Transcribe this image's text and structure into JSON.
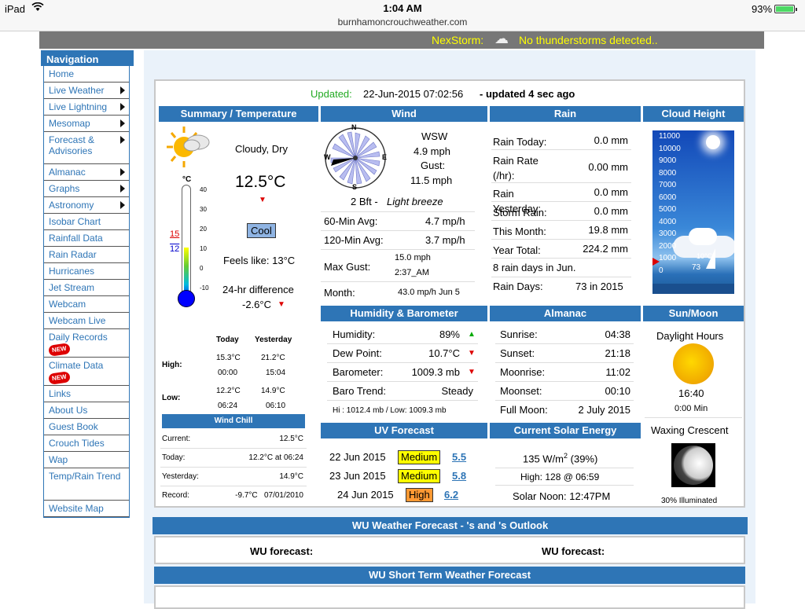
{
  "status_bar": {
    "carrier": "iPad",
    "time": "1:04 AM",
    "url": "burnhamoncrouchweather.com",
    "battery": "93%"
  },
  "nexstorm": {
    "label": "NexStorm:",
    "message": "No thunderstorms detected.."
  },
  "nav": {
    "title": "Navigation",
    "items": [
      {
        "label": "Home"
      },
      {
        "label": "Live Weather"
      },
      {
        "label": "Live Lightning"
      },
      {
        "label": "Mesomap"
      },
      {
        "label": "Forecast & Advisories"
      },
      {
        "label": "Almanac"
      },
      {
        "label": "Graphs"
      },
      {
        "label": "Astronomy"
      },
      {
        "label": "Isobar Chart"
      },
      {
        "label": "Rainfall Data"
      },
      {
        "label": "Rain Radar"
      },
      {
        "label": "Hurricanes"
      },
      {
        "label": "Jet Stream"
      },
      {
        "label": "Webcam"
      },
      {
        "label": "Webcam Live"
      },
      {
        "label": "Daily Records",
        "badge": "NEW"
      },
      {
        "label": "Climate Data",
        "badge": "NEW"
      },
      {
        "label": "Links"
      },
      {
        "label": "About Us"
      },
      {
        "label": "Guest Book"
      },
      {
        "label": "Crouch Tides"
      },
      {
        "label": "Wap"
      },
      {
        "label": "Temp/Rain Trend"
      },
      {
        "label": "Website Map"
      }
    ]
  },
  "updated": {
    "label": "Updated:",
    "datetime": "22-Jun-2015 07:02:56",
    "suffix": "- updated 4 sec ago"
  },
  "headers": {
    "summary": "Summary / Temperature",
    "wind": "Wind",
    "rain": "Rain",
    "cloud": "Cloud Height",
    "humidity": "Humidity & Barometer",
    "almanac": "Almanac",
    "sunmoon": "Sun/Moon",
    "uv": "UV Forecast",
    "solar": "Current Solar Energy",
    "windchill": "Wind Chill"
  },
  "summary": {
    "condition": "Cloudy, Dry",
    "temp": "12.5°C",
    "feel_badge": "Cool",
    "feels_like": "Feels like: 13°C",
    "diff_label": "24-hr difference",
    "diff_value": "-2.6°C",
    "thermo_unit": "°C",
    "thermo_hi": "15",
    "thermo_lo": "12",
    "thermo_ticks": [
      "40",
      "30",
      "20",
      "10",
      "0",
      "-10"
    ],
    "cols": {
      "today": "Today",
      "yesterday": "Yesterday"
    },
    "high": {
      "label": "High:",
      "today_val": "15.3°C",
      "today_time": "00:00",
      "yest_val": "21.2°C",
      "yest_time": "15:04"
    },
    "low": {
      "label": "Low:",
      "today_val": "12.2°C",
      "today_time": "06:24",
      "yest_val": "14.9°C",
      "yest_time": "06:10"
    }
  },
  "windchill": {
    "rows": [
      {
        "label": "Current:",
        "value": "12.5°C"
      },
      {
        "label": "Today:",
        "value": "12.2°C at 06:24"
      },
      {
        "label": "Yesterday:",
        "value": "14.9°C"
      },
      {
        "label": "Record:",
        "value": "-9.7°C   07/01/2010"
      }
    ]
  },
  "wind": {
    "direction": "WSW",
    "speed": "4.9 mph",
    "gust_label": "Gust:",
    "gust": "11.5 mph",
    "compass": {
      "n": "N",
      "e": "E",
      "s": "S",
      "w": "W"
    },
    "beaufort": "2 Bft -",
    "beaufort_desc": "Light breeze",
    "avg60_label": "60-Min Avg:",
    "avg60": "4.7 mp/h",
    "avg120_label": "120-Min Avg:",
    "avg120": "3.7 mp/h",
    "maxgust_label": "Max Gust:",
    "maxgust": "15.0 mph",
    "maxgust_time": "2:37_AM",
    "month_label": "Month:",
    "month": "43.0 mp/h Jun 5"
  },
  "rain": {
    "rows": [
      {
        "label": "Rain Today:",
        "value": "0.0 mm"
      },
      {
        "label": "Rain Rate (/hr):",
        "value": "0.00 mm"
      },
      {
        "label": "Rain Yesterday:",
        "value": "0.0 mm"
      },
      {
        "label": "Storm Rain:",
        "value": "0.0 mm"
      },
      {
        "label": "This Month:",
        "value": "19.8 mm"
      },
      {
        "label": "Year Total:",
        "value": "224.2 mm"
      }
    ],
    "rain_days_month": "8 rain days in Jun.",
    "rain_days_label": "Rain Days:",
    "rain_days_year": "73 in 2015"
  },
  "cloud": {
    "ticks": [
      "11000",
      "10000",
      "9000",
      "8000",
      "7000",
      "6000",
      "5000",
      "4000",
      "3000",
      "2000",
      "1000",
      "0"
    ],
    "temp_label": "10°C",
    "height_label": "73"
  },
  "humidity": {
    "rows": [
      {
        "label": "Humidity:",
        "value": "89%",
        "trend": "up"
      },
      {
        "label": "Dew Point:",
        "value": "10.7°C",
        "trend": "down"
      },
      {
        "label": "Barometer:",
        "value": "1009.3 mb",
        "trend": "down"
      },
      {
        "label": "Baro Trend:",
        "value": "Steady",
        "trend": ""
      }
    ],
    "hilo": "Hi : 1012.4 mb / Low:  1009.3 mb"
  },
  "almanac": {
    "rows": [
      {
        "label": "Sunrise:",
        "value": "04:38"
      },
      {
        "label": "Sunset:",
        "value": "21:18"
      },
      {
        "label": "Moonrise:",
        "value": "11:02"
      },
      {
        "label": "Moonset:",
        "value": "00:10"
      },
      {
        "label": "Full Moon:",
        "value": "2 July 2015"
      }
    ]
  },
  "sunmoon": {
    "daylight_label": "Daylight Hours",
    "daylight": "16:40",
    "change": "0:00 Min",
    "phase": "Waxing Crescent",
    "illuminated": "30% Illuminated"
  },
  "uv": {
    "rows": [
      {
        "date": "22 Jun 2015",
        "level": "Medium",
        "value": "5.5",
        "color": "#ffff00"
      },
      {
        "date": "23 Jun 2015",
        "level": "Medium",
        "value": "5.8",
        "color": "#ffff00"
      },
      {
        "date": "24 Jun 2015",
        "level": "High",
        "value": "6.2",
        "color": "#ff9933"
      }
    ]
  },
  "solar": {
    "value": "135 W/m",
    "sup": "2",
    "percent": " (39%)",
    "high": "High: 128 @  06:59",
    "noon": "Solar Noon: 12:47PM"
  },
  "wu": {
    "outlook_title": "WU Weather Forecast  -   's and 's Outlook",
    "forecast_label_1": "WU forecast:",
    "forecast_label_2": "WU forecast:",
    "short_term_title": "WU Short Term Weather Forecast"
  },
  "colors": {
    "accent": "#2e75b6",
    "nexstorm_text": "#ffff00",
    "updated_label": "#22aa22"
  }
}
